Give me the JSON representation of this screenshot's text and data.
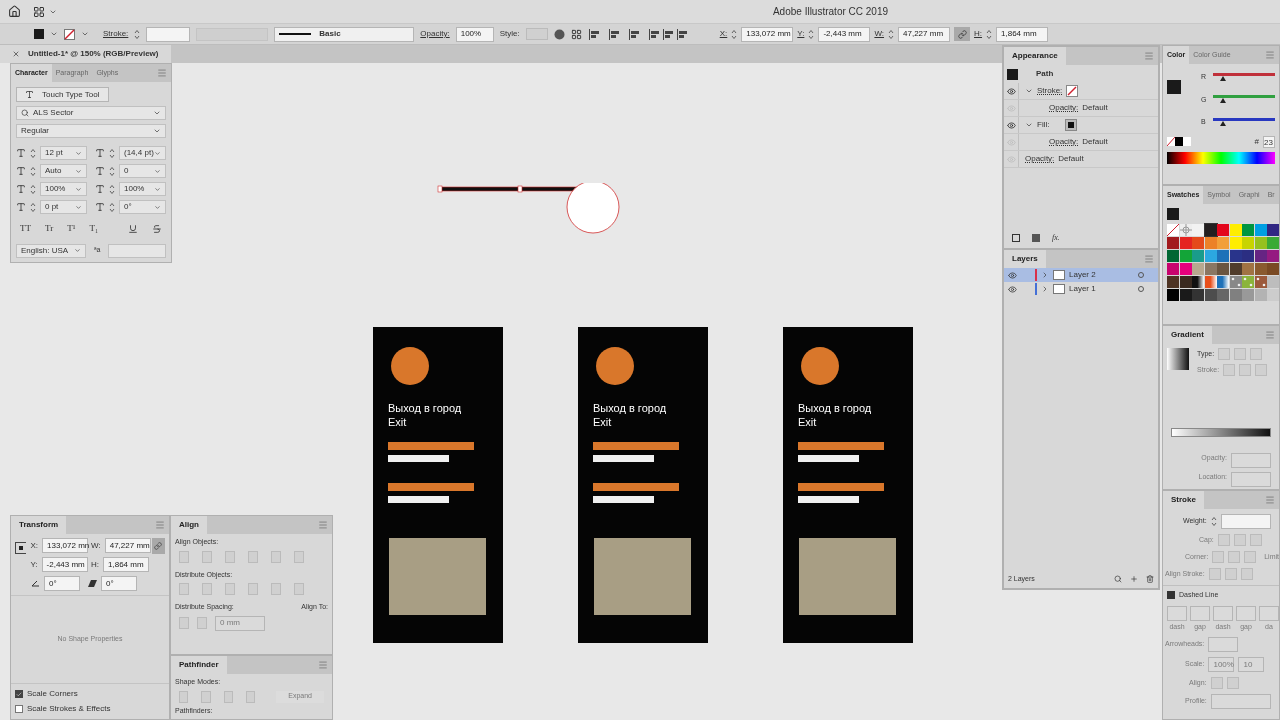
{
  "app_bar": {
    "title": "Adobe Illustrator CC 2019"
  },
  "control_bar": {
    "stroke_label": "Stroke:",
    "brush": "Basic",
    "opacity_label": "Opacity:",
    "opacity": "100%",
    "style_label": "Style:",
    "fields": [
      {
        "label": "X:",
        "value": "133,072 mm"
      },
      {
        "label": "Y:",
        "value": "-2,443 mm"
      },
      {
        "label": "W:",
        "value": "47,227 mm"
      },
      {
        "label": "H:",
        "value": "1,864 mm"
      }
    ],
    "constrain": true
  },
  "document_tab": {
    "title": "Untitled-1* @ 150% (RGB/Preview)"
  },
  "character_panel": {
    "tabs": [
      {
        "label": "Character",
        "selected": true
      },
      {
        "label": "Paragraph",
        "selected": false
      },
      {
        "label": "Glyphs",
        "selected": false
      }
    ],
    "tool_button": "Touch Type Tool",
    "font": "ALS Sector",
    "style": "Regular",
    "fields": [
      "12 pt",
      "(14,4 pt)",
      "Auto",
      "0",
      "100%",
      "100%",
      "0 pt",
      "0°"
    ],
    "type_buttons": [
      "TT",
      "Tr",
      "T¹",
      "T₁"
    ],
    "language": "English: USA",
    "hyphen_label": "ªa"
  },
  "appearance_panel": {
    "title": "Appearance",
    "object": "Path",
    "rows": [
      {
        "kind": "stroke",
        "label": "Stroke:",
        "visible": true,
        "expanded": true,
        "children": [
          {
            "kind": "opacity",
            "label": "Opacity:",
            "value": "Default",
            "visible": false
          }
        ]
      },
      {
        "kind": "fill",
        "label": "Fill:",
        "visible": true,
        "expanded": true,
        "children": [
          {
            "kind": "opacity",
            "label": "Opacity:",
            "value": "Default",
            "visible": false
          }
        ]
      },
      {
        "kind": "opacity",
        "label": "Opacity:",
        "value": "Default",
        "visible": false
      }
    ],
    "fx": "fx."
  },
  "layers_panel": {
    "title": "Layers",
    "layers": [
      {
        "name": "Layer 2",
        "selected": true,
        "color": "#d8304a"
      },
      {
        "name": "Layer 1",
        "selected": false,
        "color": "#4470d6"
      }
    ],
    "count": "2 Layers"
  },
  "color_panel": {
    "tabs": [
      {
        "label": "Color",
        "selected": true
      },
      {
        "label": "Color Guide",
        "selected": false
      }
    ],
    "channels": [
      {
        "label": "R",
        "level": 0.12
      },
      {
        "label": "G",
        "level": 0.12
      },
      {
        "label": "B",
        "level": 0.12
      }
    ],
    "hex_label": "#",
    "hex": "23"
  },
  "swatches_panel": {
    "tabs": [
      {
        "label": "Swatches",
        "selected": true
      },
      {
        "label": "Symbol",
        "selected": false
      },
      {
        "label": "Graphi",
        "selected": false
      },
      {
        "label": "Br",
        "selected": false
      }
    ],
    "swatches": [
      {
        "kind": "none",
        "selected": false
      },
      {
        "kind": "registration",
        "selected": false
      },
      {
        "kind": "color",
        "color": "#f2f2f2",
        "selected": false
      },
      {
        "kind": "color",
        "color": "#231f20",
        "selected": true
      },
      {
        "kind": "color",
        "color": "#e3061c",
        "selected": false
      },
      {
        "kind": "color",
        "color": "#ffed00",
        "selected": false
      },
      {
        "kind": "color",
        "color": "#009640",
        "selected": false
      },
      {
        "kind": "color",
        "color": "#009fe3",
        "selected": false
      },
      {
        "kind": "color",
        "color": "#312783",
        "selected": false
      },
      {
        "kind": "color",
        "color": "#a21a1e",
        "selected": false
      },
      {
        "kind": "color",
        "color": "#e52421",
        "selected": false
      },
      {
        "kind": "color",
        "color": "#e4491b",
        "selected": false
      },
      {
        "kind": "color",
        "color": "#ec8128",
        "selected": false
      },
      {
        "kind": "color",
        "color": "#f29f3a",
        "selected": false
      },
      {
        "kind": "color",
        "color": "#ffed00",
        "selected": false
      },
      {
        "kind": "color",
        "color": "#c8d400",
        "selected": false
      },
      {
        "kind": "color",
        "color": "#95c11f",
        "selected": false
      },
      {
        "kind": "color",
        "color": "#3aaa35",
        "selected": false
      },
      {
        "kind": "color",
        "color": "#006633",
        "selected": false
      },
      {
        "kind": "color",
        "color": "#13a538",
        "selected": false
      },
      {
        "kind": "color",
        "color": "#1a9c8c",
        "selected": false
      },
      {
        "kind": "color",
        "color": "#2ca8e0",
        "selected": false
      },
      {
        "kind": "color",
        "color": "#1d71b8",
        "selected": false
      },
      {
        "kind": "color",
        "color": "#29348b",
        "selected": false
      },
      {
        "kind": "color",
        "color": "#2b2e82",
        "selected": false
      },
      {
        "kind": "color",
        "color": "#662483",
        "selected": false
      },
      {
        "kind": "color",
        "color": "#951b81",
        "selected": false
      },
      {
        "kind": "color",
        "color": "#c8046e",
        "selected": false
      },
      {
        "kind": "color",
        "color": "#e5007d",
        "selected": false
      },
      {
        "kind": "color",
        "color": "#b8a88f",
        "selected": false
      },
      {
        "kind": "color",
        "color": "#8a7763",
        "selected": false
      },
      {
        "kind": "color",
        "color": "#6a5540",
        "selected": false
      },
      {
        "kind": "color",
        "color": "#503c2b",
        "selected": false
      },
      {
        "kind": "color",
        "color": "#a07344",
        "selected": false
      },
      {
        "kind": "color",
        "color": "#8a5a2f",
        "selected": false
      },
      {
        "kind": "color",
        "color": "#7a4a24",
        "selected": false
      },
      {
        "kind": "color",
        "color": "#4e3424",
        "selected": false
      },
      {
        "kind": "color",
        "color": "#3a2a20",
        "selected": false
      },
      {
        "kind": "gradient",
        "color": "#111111",
        "selected": false
      },
      {
        "kind": "gradient",
        "color": "#e8501c",
        "selected": false
      },
      {
        "kind": "gradient",
        "color": "#1d71b8",
        "selected": false
      },
      {
        "kind": "pattern",
        "color": "#888888",
        "selected": false
      },
      {
        "kind": "pattern",
        "color": "#8bb43c",
        "selected": false
      },
      {
        "kind": "pattern",
        "color": "#9c5a3c",
        "selected": false
      },
      {
        "kind": "color",
        "color": "#bdbdbd",
        "selected": false
      },
      {
        "kind": "color",
        "color": "#000000",
        "selected": false
      },
      {
        "kind": "color",
        "color": "#1a1a1a",
        "selected": false
      },
      {
        "kind": "color",
        "color": "#333333",
        "selected": false
      },
      {
        "kind": "color",
        "color": "#4d4d4d",
        "selected": false
      },
      {
        "kind": "color",
        "color": "#666666",
        "selected": false
      },
      {
        "kind": "color",
        "color": "#808080",
        "selected": false
      },
      {
        "kind": "color",
        "color": "#999999",
        "selected": false
      },
      {
        "kind": "color",
        "color": "#b3b3b3",
        "selected": false
      },
      {
        "kind": "color",
        "color": "#cccccc",
        "selected": false
      }
    ]
  },
  "gradient_panel": {
    "title": "Gradient",
    "type_label": "Type:",
    "stroke_label": "Stroke:",
    "opacity_label": "Opacity:",
    "location_label": "Location:"
  },
  "stroke_panel": {
    "title": "Stroke",
    "weight_label": "Weight:",
    "cap_label": "Cap:",
    "corner_label": "Corner:",
    "limit_label": "Limit",
    "align_label": "Align Stroke:",
    "dashed_label": "Dashed Line",
    "dashed": true,
    "dash_labels": [
      "dash",
      "gap",
      "dash",
      "gap",
      "da"
    ],
    "arrowheads_label": "Arrowheads:",
    "scale_label": "Scale:",
    "scale_values": [
      "100%",
      "10"
    ],
    "arrow_align_label": "Align:",
    "profile_label": "Profile:"
  },
  "transform_panel": {
    "title": "Transform",
    "fields": [
      {
        "label": "X:",
        "value": "133,072 mn"
      },
      {
        "label": "W:",
        "value": "47,227 mm"
      },
      {
        "label": "Y:",
        "value": "-2,443 mm"
      },
      {
        "label": "H:",
        "value": "1,864 mm"
      }
    ],
    "angle": "0°",
    "shear": "0°",
    "empty_note": "No Shape Properties",
    "options": [
      {
        "label": "Scale Corners",
        "checked": true
      },
      {
        "label": "Scale Strokes & Effects",
        "checked": false
      }
    ]
  },
  "align_panel": {
    "title": "Align",
    "align_objects": "Align Objects:",
    "distribute_objects": "Distribute Objects:",
    "distribute_spacing": "Distribute Spacing:",
    "align_to": "Align To:",
    "spacing": "0 mm"
  },
  "pathfinder_panel": {
    "title": "Pathfinder",
    "shape_modes": "Shape Modes:",
    "expand": "Expand",
    "pathfinders": "Pathfinders:"
  },
  "artboards": [
    {
      "title": "Выход в город",
      "subtitle": "Exit"
    },
    {
      "title": "Выход в город",
      "subtitle": "Exit"
    },
    {
      "title": "Выход в город",
      "subtitle": "Exit"
    }
  ]
}
